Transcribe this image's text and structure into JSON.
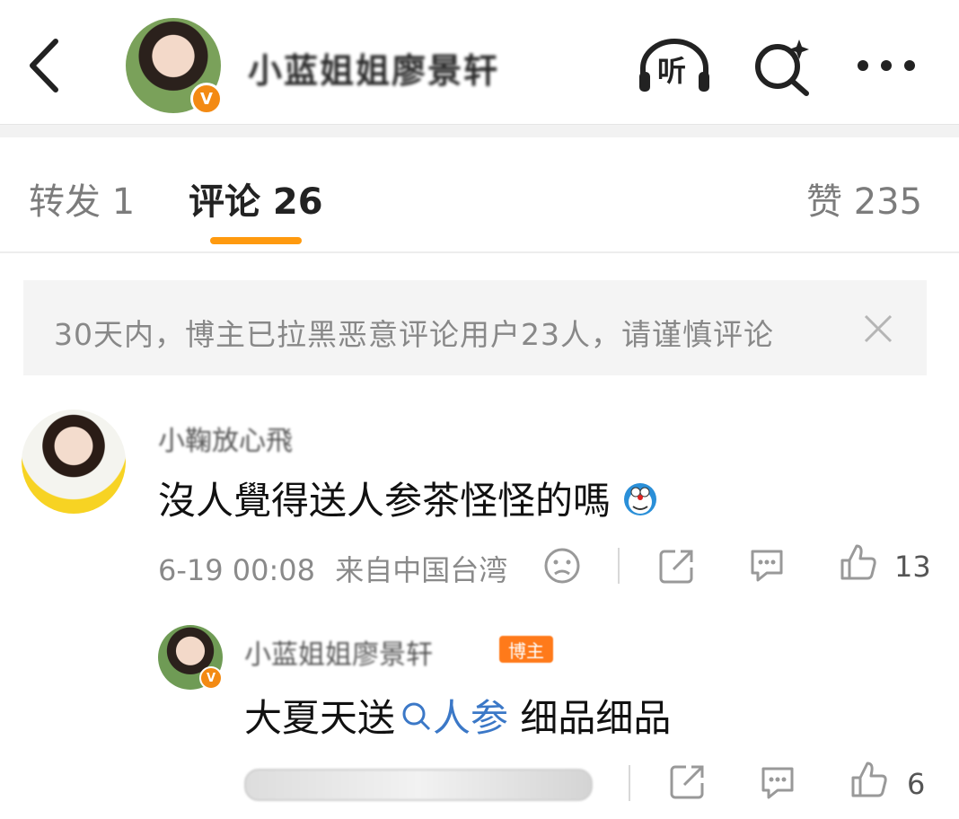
{
  "header": {
    "title": "小蓝姐姐廖景轩",
    "verified_badge": "V",
    "icons": {
      "back": "back-arrow-icon",
      "listen": "headphones-icon",
      "listen_label": "听",
      "search": "search-icon",
      "more": "more-icon"
    }
  },
  "tabs": [
    {
      "label": "转发 1"
    },
    {
      "label": "评论 26"
    },
    {
      "label": "赞 235"
    }
  ],
  "notice": {
    "text": "30天内，博主已拉黑恶意评论用户23人，请谨慎评论"
  },
  "comments": [
    {
      "username": "小鞠放心飛",
      "text": "沒人覺得送人参茶怪怪的嗎",
      "emoji": "doraemon-emoji-icon",
      "date": "6-19 00:08",
      "location": "来自中国台湾",
      "likes": "13"
    }
  ],
  "reply": {
    "username": "小蓝姐姐廖景轩",
    "badge": "博主",
    "text_before": "大夏天送",
    "link": "人参",
    "text_after": " 细品细品",
    "likes": "6"
  },
  "colors": {
    "accent": "#ff9a0f",
    "link": "#3b78c7",
    "badge": "#f38a13"
  }
}
